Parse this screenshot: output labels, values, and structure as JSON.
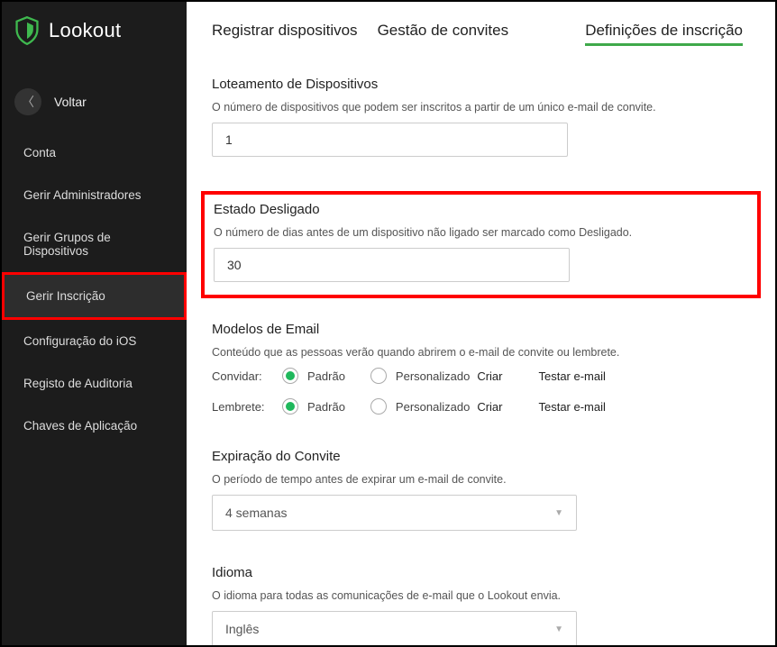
{
  "brand": "Lookout",
  "sidebar": {
    "back": "Voltar",
    "items": [
      "Conta",
      "Gerir Administradores",
      "Gerir Grupos de Dispositivos",
      "Gerir Inscrição",
      "Configuração do iOS",
      "Registo de Auditoria",
      "Chaves de Aplicação"
    ]
  },
  "tabs": [
    "Registrar dispositivos",
    "Gestão de convites",
    "Definições de inscrição"
  ],
  "sections": {
    "allotment": {
      "title": "Loteamento de Dispositivos",
      "desc": "O número de dispositivos que podem ser inscritos a partir de um único e-mail de convite.",
      "value": "1"
    },
    "disconnected": {
      "title": "Estado Desligado",
      "desc": "O número de dias antes de um dispositivo não ligado ser marcado como Desligado.",
      "value": "30"
    },
    "email": {
      "title": "Modelos de Email",
      "desc": "Conteúdo que as pessoas verão quando abrirem o e-mail de convite ou lembrete.",
      "row1_label": "Convidar:",
      "row2_label": "Lembrete:",
      "opt_default": "Padrão",
      "opt_custom": "Personalizado",
      "create": "Criar",
      "test": "Testar e-mail"
    },
    "expiration": {
      "title": "Expiração do Convite",
      "desc": "O período de tempo antes de expirar um e-mail de convite.",
      "value": "4 semanas"
    },
    "language": {
      "title": "Idioma",
      "desc": "O idioma para todas as comunicações de e-mail que o Lookout envia.",
      "value": "Inglês"
    }
  }
}
